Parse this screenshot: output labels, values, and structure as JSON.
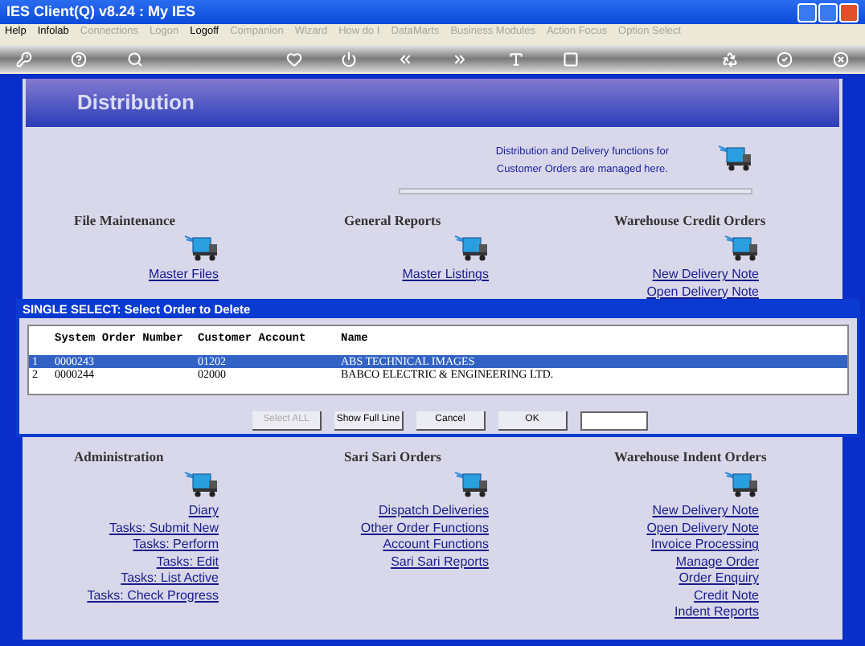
{
  "window": {
    "title": "IES Client(Q) v8.24 : My IES"
  },
  "menu": [
    {
      "label": "Help",
      "disabled": false
    },
    {
      "label": "Infolab",
      "disabled": false
    },
    {
      "label": "Connections",
      "disabled": true
    },
    {
      "label": "Logon",
      "disabled": true
    },
    {
      "label": "Logoff",
      "disabled": false
    },
    {
      "label": "Companion",
      "disabled": true
    },
    {
      "label": "Wizard",
      "disabled": true
    },
    {
      "label": "How do I",
      "disabled": true
    },
    {
      "label": "DataMarts",
      "disabled": true
    },
    {
      "label": "Business Modules",
      "disabled": true
    },
    {
      "label": "Action Focus",
      "disabled": true
    },
    {
      "label": "Option Select",
      "disabled": true
    }
  ],
  "page": {
    "title": "Distribution",
    "intro": [
      "Distribution and Delivery functions for",
      "Customer Orders are managed here."
    ]
  },
  "sections_top": [
    {
      "heading": "File Maintenance",
      "links": [
        "Master Files"
      ]
    },
    {
      "heading": "General Reports",
      "links": [
        "Master Listings"
      ]
    },
    {
      "heading": "Warehouse Credit Orders",
      "links": [
        "New Delivery Note",
        "Open Delivery Note"
      ]
    }
  ],
  "sections_bottom": [
    {
      "heading": "Administration",
      "links": [
        "Diary",
        "Tasks: Submit New",
        "Tasks: Perform",
        "Tasks: Edit",
        "Tasks: List Active",
        "Tasks: Check Progress"
      ]
    },
    {
      "heading": "Sari Sari Orders",
      "links": [
        "Dispatch Deliveries",
        "Other Order Functions",
        "Account Functions",
        "Sari Sari Reports"
      ]
    },
    {
      "heading": "Warehouse Indent Orders",
      "links": [
        "New Delivery Note",
        "Open Delivery Note",
        "Invoice Processing",
        "Manage Order",
        "Order Enquiry",
        "Credit Note",
        "Indent Reports"
      ]
    }
  ],
  "dialog": {
    "title": "SINGLE SELECT: Select Order to Delete",
    "columns": [
      "System Order Number",
      "Customer Account",
      "Name"
    ],
    "rows": [
      {
        "index": "1",
        "order": "0000243",
        "account": "01202",
        "name": "ABS TECHNICAL IMAGES",
        "selected": true
      },
      {
        "index": "2",
        "order": "0000244",
        "account": "02000",
        "name": "BABCO ELECTRIC & ENGINEERING LTD.",
        "selected": false
      }
    ],
    "buttons": [
      {
        "label": "Select ALL",
        "disabled": true
      },
      {
        "label": "Show Full Line",
        "disabled": false
      },
      {
        "label": "Cancel",
        "disabled": false
      },
      {
        "label": "OK",
        "disabled": false
      }
    ]
  }
}
